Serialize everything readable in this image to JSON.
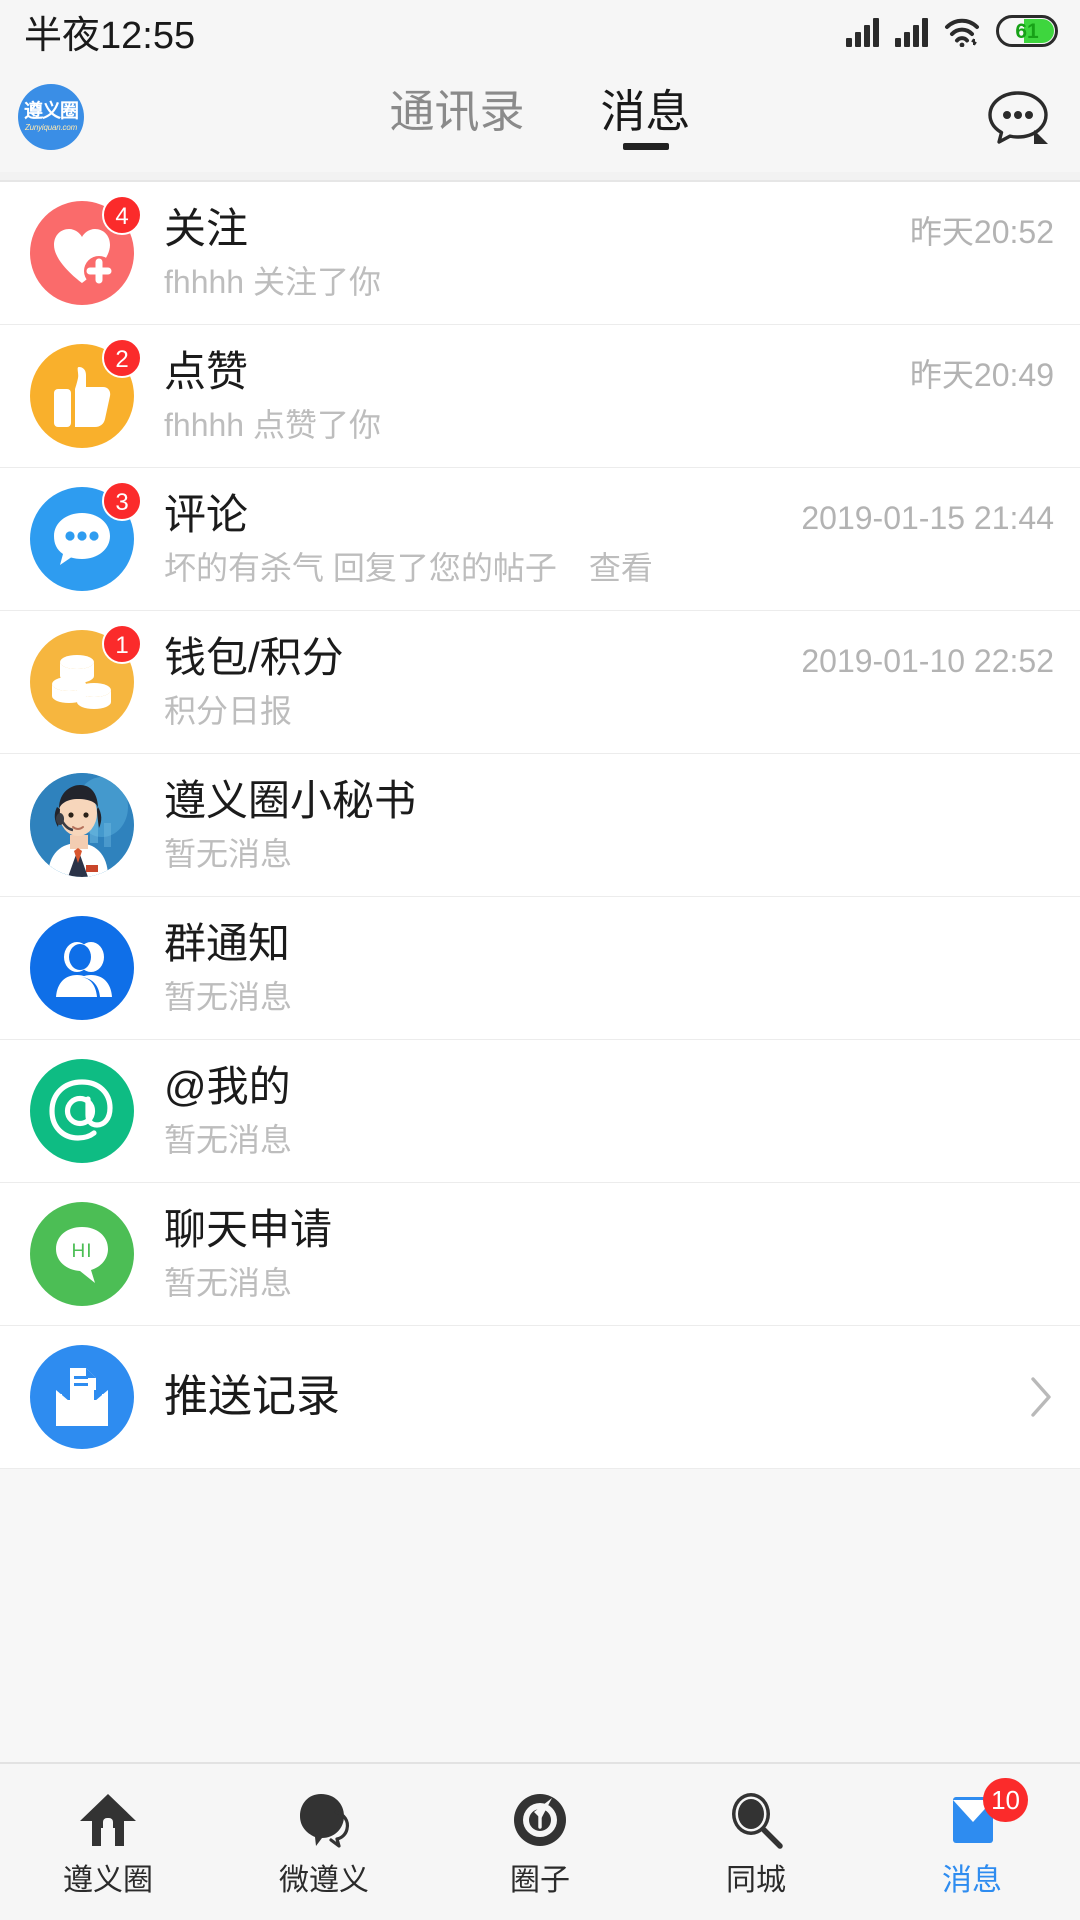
{
  "status_bar": {
    "time": "半夜12:55",
    "battery_level": "61",
    "icons": [
      "signal-icon",
      "signal-icon",
      "wifi-icon",
      "battery-icon"
    ]
  },
  "header": {
    "logo": {
      "cn": "遵义圈",
      "en": "Zunyiquan.com"
    },
    "tabs": [
      {
        "label": "通讯录",
        "active": false
      },
      {
        "label": "消息",
        "active": true
      }
    ],
    "action_icon": "chat-more-icon"
  },
  "messages": [
    {
      "icon": "heart-plus-icon",
      "icon_color": "#fa6b6b",
      "title": "关注",
      "time": "昨天20:52",
      "subtitle": "fhhhh 关注了你",
      "badge": "4"
    },
    {
      "icon": "thumbs-up-icon",
      "icon_color": "#f9b02c",
      "title": "点赞",
      "time": "昨天20:49",
      "subtitle": "fhhhh 点赞了你",
      "badge": "2"
    },
    {
      "icon": "comment-bubble-icon",
      "icon_color": "#2e9cf0",
      "title": "评论",
      "time": "2019-01-15 21:44",
      "subtitle": "坏的有杀气 回复了您的帖子　查看",
      "badge": "3"
    },
    {
      "icon": "coins-icon",
      "icon_color": "#f6b63f",
      "title": "钱包/积分",
      "time": "2019-01-10 22:52",
      "subtitle": "积分日报",
      "badge": "1"
    },
    {
      "icon": "secretary-avatar",
      "icon_color": "#2a7bb8",
      "title": "遵义圈小秘书",
      "time": "",
      "subtitle": "暂无消息",
      "badge": ""
    },
    {
      "icon": "group-person-icon",
      "icon_color": "#0f6fe8",
      "title": "群通知",
      "time": "",
      "subtitle": "暂无消息",
      "badge": ""
    },
    {
      "icon": "at-sign-icon",
      "icon_color": "#0ebc83",
      "title": "@我的",
      "time": "",
      "subtitle": "暂无消息",
      "badge": ""
    },
    {
      "icon": "hi-bubble-icon",
      "icon_color": "#4cbe55",
      "title": "聊天申请",
      "time": "",
      "subtitle": "暂无消息",
      "badge": ""
    }
  ],
  "push_record": {
    "icon": "inbox-doc-icon",
    "icon_color": "#2e8cf0",
    "title": "推送记录",
    "chevron": "chevron-right-icon"
  },
  "tabbar": [
    {
      "icon": "home-icon",
      "label": "遵义圈",
      "active": false,
      "badge": ""
    },
    {
      "icon": "speech-bubble-icon",
      "label": "微遵义",
      "active": false,
      "badge": ""
    },
    {
      "icon": "compass-icon",
      "label": "圈子",
      "active": false,
      "badge": ""
    },
    {
      "icon": "search-icon",
      "label": "同城",
      "active": false,
      "badge": ""
    },
    {
      "icon": "envelope-icon",
      "label": "消息",
      "active": true,
      "badge": "10"
    }
  ],
  "colors": {
    "accent": "#2e8cf0",
    "badge_red": "#fb2b2b",
    "bg": "#f6f6f6"
  }
}
